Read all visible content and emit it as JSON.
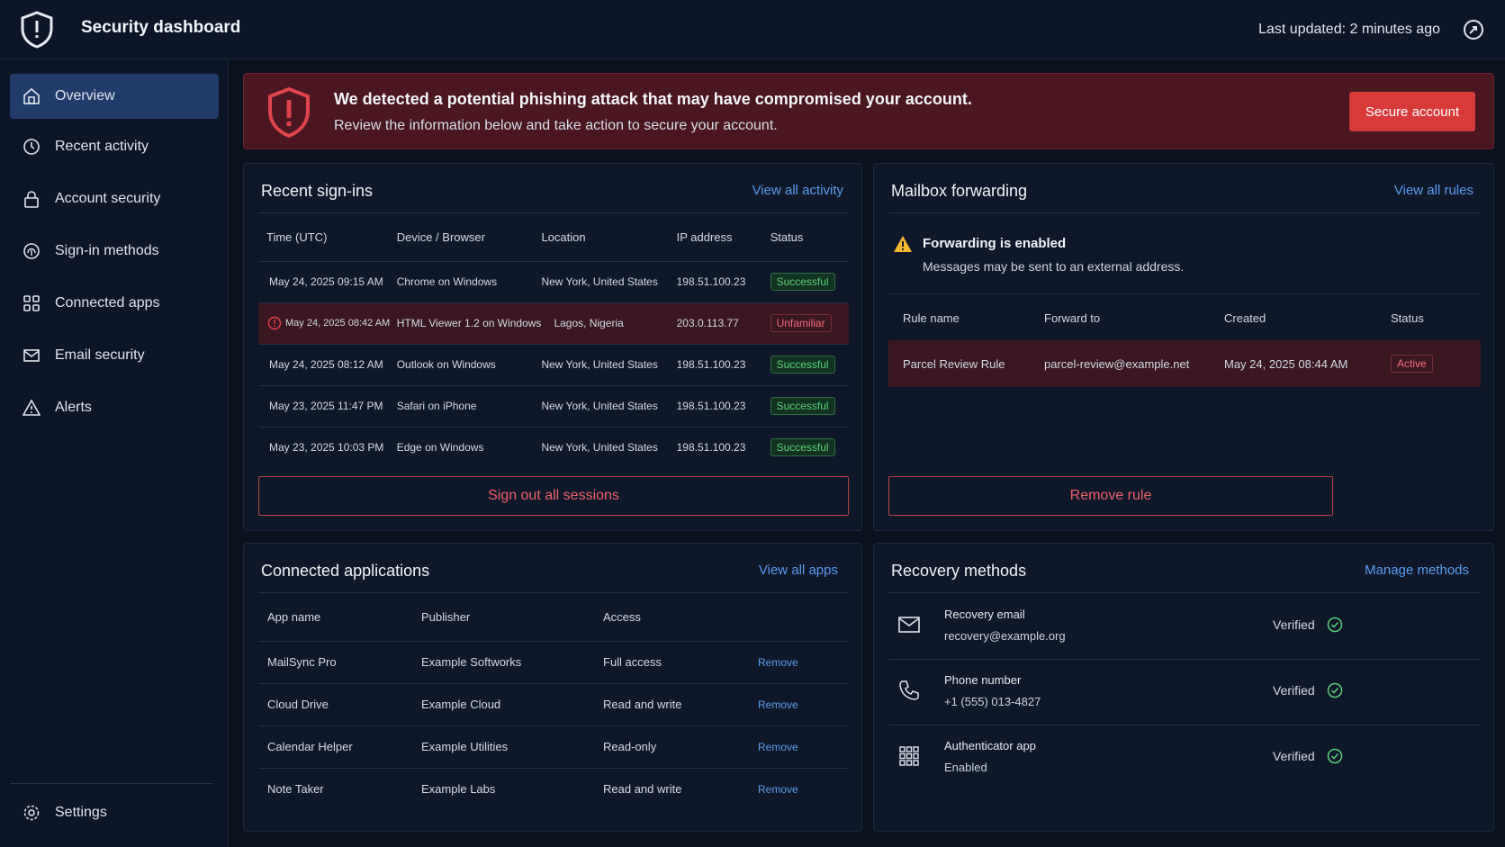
{
  "header": {
    "title": "Security dashboard",
    "last_updated": "Last updated: 2 minutes ago"
  },
  "sidebar": {
    "items": [
      {
        "label": "Overview",
        "icon": "home-icon",
        "active": true
      },
      {
        "label": "Recent activity",
        "icon": "clock-icon"
      },
      {
        "label": "Account security",
        "icon": "lock-icon"
      },
      {
        "label": "Sign-in methods",
        "icon": "fingerprint-icon"
      },
      {
        "label": "Connected apps",
        "icon": "grid-icon"
      },
      {
        "label": "Email security",
        "icon": "mail-icon"
      },
      {
        "label": "Alerts",
        "icon": "warning-icon"
      }
    ],
    "settings_label": "Settings"
  },
  "alert": {
    "title": "We detected a potential phishing attack that may have compromised your account.",
    "subtitle": "Review the information below and take action to secure your account.",
    "button": "Secure account"
  },
  "signins": {
    "title": "Recent sign-ins",
    "link": "View all activity",
    "columns": [
      "Time (UTC)",
      "Device / Browser",
      "Location",
      "IP address",
      "Status"
    ],
    "rows": [
      {
        "time": "May 24, 2025 09:15 AM",
        "device": "Chrome on Windows",
        "location": "New York, United States",
        "ip": "198.51.100.23",
        "status": "Successful"
      },
      {
        "time": "May 24, 2025 08:42 AM",
        "device": "HTML Viewer 1.2 on Windows",
        "location": "Lagos, Nigeria",
        "ip": "203.0.113.77",
        "status": "Unfamiliar"
      },
      {
        "time": "May 24, 2025 08:12 AM",
        "device": "Outlook on Windows",
        "location": "New York, United States",
        "ip": "198.51.100.23",
        "status": "Successful"
      },
      {
        "time": "May 23, 2025 11:47 PM",
        "device": "Safari on iPhone",
        "location": "New York, United States",
        "ip": "198.51.100.23",
        "status": "Successful"
      },
      {
        "time": "May 23, 2025 10:03 PM",
        "device": "Edge on Windows",
        "location": "New York, United States",
        "ip": "198.51.100.23",
        "status": "Successful"
      }
    ],
    "button": "Sign out all sessions"
  },
  "forwarding": {
    "title": "Mailbox forwarding",
    "link": "View all rules",
    "warning_title": "Forwarding is enabled",
    "warning_sub": "Messages may be sent to an external address.",
    "columns": [
      "Rule name",
      "Forward to",
      "Created",
      "Status"
    ],
    "rows": [
      {
        "name": "Parcel Review Rule",
        "forward_to": "parcel-review@example.net",
        "created": "May 24, 2025 08:44 AM",
        "status": "Active"
      }
    ],
    "button": "Remove rule"
  },
  "apps": {
    "title": "Connected applications",
    "link": "View all apps",
    "columns": [
      "App name",
      "Publisher",
      "Access"
    ],
    "rows": [
      {
        "name": "MailSync Pro",
        "publisher": "Example Softworks",
        "access": "Full access",
        "action": "Remove"
      },
      {
        "name": "Cloud Drive",
        "publisher": "Example Cloud",
        "access": "Read and write",
        "action": "Remove"
      },
      {
        "name": "Calendar Helper",
        "publisher": "Example Utilities",
        "access": "Read-only",
        "action": "Remove"
      },
      {
        "name": "Note Taker",
        "publisher": "Example Labs",
        "access": "Read and write",
        "action": "Remove"
      }
    ]
  },
  "recovery": {
    "title": "Recovery methods",
    "link": "Manage methods",
    "items": [
      {
        "label": "Recovery email",
        "value": "recovery@example.org",
        "status": "Verified",
        "icon": "mail-icon"
      },
      {
        "label": "Phone number",
        "value": "+1 (555) 013-4827",
        "status": "Verified",
        "icon": "phone-icon"
      },
      {
        "label": "Authenticator app",
        "value": "Enabled",
        "status": "Verified",
        "icon": "keypad-icon"
      }
    ]
  },
  "colors": {
    "accent": "#5b9cf0",
    "danger": "#d83a3a",
    "success": "#5bd07a",
    "warning": "#f5b731"
  }
}
